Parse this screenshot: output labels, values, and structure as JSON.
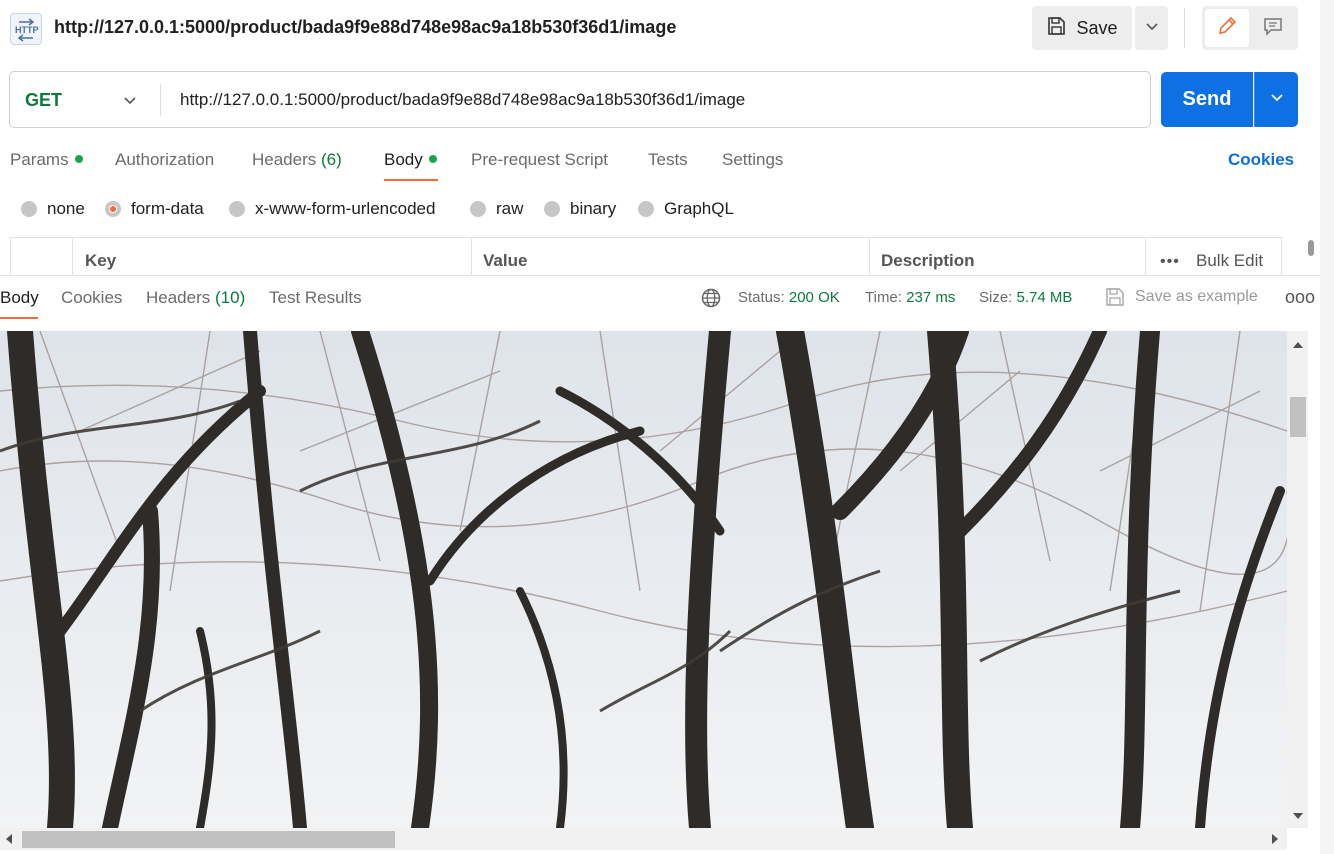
{
  "header": {
    "title": "http://127.0.0.1:5000/product/bada9f9e88d748e98ac9a18b530f36d1/image",
    "save_label": "Save",
    "icon": "http-icon"
  },
  "request": {
    "method": "GET",
    "url": "http://127.0.0.1:5000/product/bada9f9e88d748e98ac9a18b530f36d1/image",
    "send_label": "Send"
  },
  "request_tabs": {
    "params": "Params",
    "authorization": "Authorization",
    "headers": "Headers",
    "headers_count": "(6)",
    "body": "Body",
    "pre_request": "Pre-request Script",
    "tests": "Tests",
    "settings": "Settings",
    "cookies": "Cookies"
  },
  "body_types": {
    "none": "none",
    "form_data": "form-data",
    "urlencoded": "x-www-form-urlencoded",
    "raw": "raw",
    "binary": "binary",
    "graphql": "GraphQL",
    "selected": "form-data"
  },
  "kv_table": {
    "key": "Key",
    "value": "Value",
    "description": "Description",
    "bulk_edit": "Bulk Edit"
  },
  "response_tabs": {
    "body": "Body",
    "cookies": "Cookies",
    "headers": "Headers",
    "headers_count": "(10)",
    "test_results": "Test Results"
  },
  "response_meta": {
    "status_label": "Status:",
    "status_value": "200 OK",
    "time_label": "Time:",
    "time_value": "237 ms",
    "size_label": "Size:",
    "size_value": "5.74 MB",
    "save_example": "Save as example"
  },
  "colors": {
    "accent": "#f26b3a",
    "send": "#0d71e3",
    "success": "#0b7a3e",
    "link": "#0d6fd4"
  }
}
